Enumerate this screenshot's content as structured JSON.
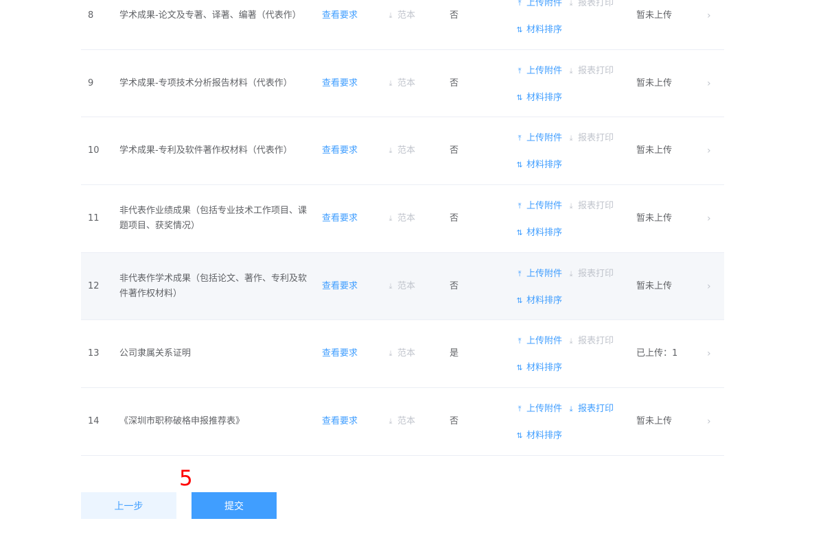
{
  "table": {
    "rows": [
      {
        "no": "8",
        "name": "学术成果-论文及专著、译著、编著（代表作）",
        "view_req": "查看要求",
        "template": "范本",
        "required": "否",
        "upload": "上传附件",
        "print": "报表打印",
        "sort": "材料排序",
        "status": "暂未上传"
      },
      {
        "no": "9",
        "name": "学术成果-专项技术分析报告材料（代表作）",
        "view_req": "查看要求",
        "template": "范本",
        "required": "否",
        "upload": "上传附件",
        "print": "报表打印",
        "sort": "材料排序",
        "status": "暂未上传"
      },
      {
        "no": "10",
        "name": "学术成果-专利及软件著作权材料（代表作）",
        "view_req": "查看要求",
        "template": "范本",
        "required": "否",
        "upload": "上传附件",
        "print": "报表打印",
        "sort": "材料排序",
        "status": "暂未上传"
      },
      {
        "no": "11",
        "name": "非代表作业绩成果（包括专业技术工作项目、课题项目、获奖情况）",
        "view_req": "查看要求",
        "template": "范本",
        "required": "否",
        "upload": "上传附件",
        "print": "报表打印",
        "sort": "材料排序",
        "status": "暂未上传"
      },
      {
        "no": "12",
        "name": "非代表作学术成果（包括论文、著作、专利及软件著作权材料）",
        "view_req": "查看要求",
        "template": "范本",
        "required": "否",
        "upload": "上传附件",
        "print": "报表打印",
        "sort": "材料排序",
        "status": "暂未上传"
      },
      {
        "no": "13",
        "name": "公司隶属关系证明",
        "view_req": "查看要求",
        "template": "范本",
        "required": "是",
        "upload": "上传附件",
        "print": "报表打印",
        "sort": "材料排序",
        "status": "已上传：1"
      },
      {
        "no": "14",
        "name": "《深圳市职称破格申报推荐表》",
        "view_req": "查看要求",
        "template": "范本",
        "required": "否",
        "upload": "上传附件",
        "print": "报表打印",
        "sort": "材料排序",
        "status": "暂未上传"
      }
    ]
  },
  "annotation": {
    "step": "5"
  },
  "footer": {
    "prev_label": "上一步",
    "submit_label": "提交"
  },
  "colors": {
    "primary": "#409eff",
    "disabled": "#c0c4cc",
    "annotation": "#ff0000"
  },
  "icons": {
    "upload": "upload-icon",
    "download": "download-icon",
    "sort": "sort-icon",
    "arrow": "chevron-right-icon"
  }
}
